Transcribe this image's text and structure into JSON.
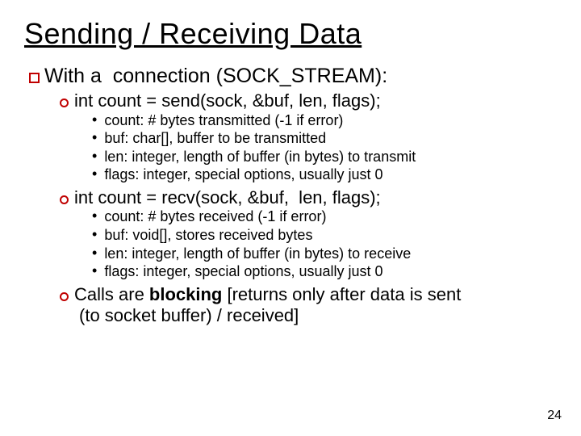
{
  "title": "Sending / Receiving Data",
  "lvl1": {
    "prefix": "With a  connection (",
    "em": "SOCK_STREAM",
    "suffix": "):"
  },
  "send": {
    "call": "int count = send(sock, &buf, len, flags);",
    "items": [
      {
        "term": "count:",
        "desc": " # bytes transmitted (-1 if error)"
      },
      {
        "term": "buf:",
        "desc": " char[], buffer to be transmitted"
      },
      {
        "term": "len:",
        "desc": " integer, length of buffer (in bytes) to transmit"
      },
      {
        "term": "flags:",
        "desc": " integer, special options, usually just 0"
      }
    ]
  },
  "recv": {
    "call": "int count = recv(sock, &buf,  len, flags);",
    "items": [
      {
        "term": "count:",
        "desc": " # bytes received (-1 if error)"
      },
      {
        "term": "buf:",
        "desc": " void[], stores received bytes"
      },
      {
        "term": "len:",
        "desc": " integer, length of buffer (in bytes) to receive"
      },
      {
        "term": "flags:",
        "desc": " integer, special options, usually just 0"
      }
    ]
  },
  "final": {
    "a": "Calls are ",
    "b": "blocking",
    "c": " [returns only after data is sent",
    "d": "(to socket buffer) / received]"
  },
  "pagenum": "24"
}
